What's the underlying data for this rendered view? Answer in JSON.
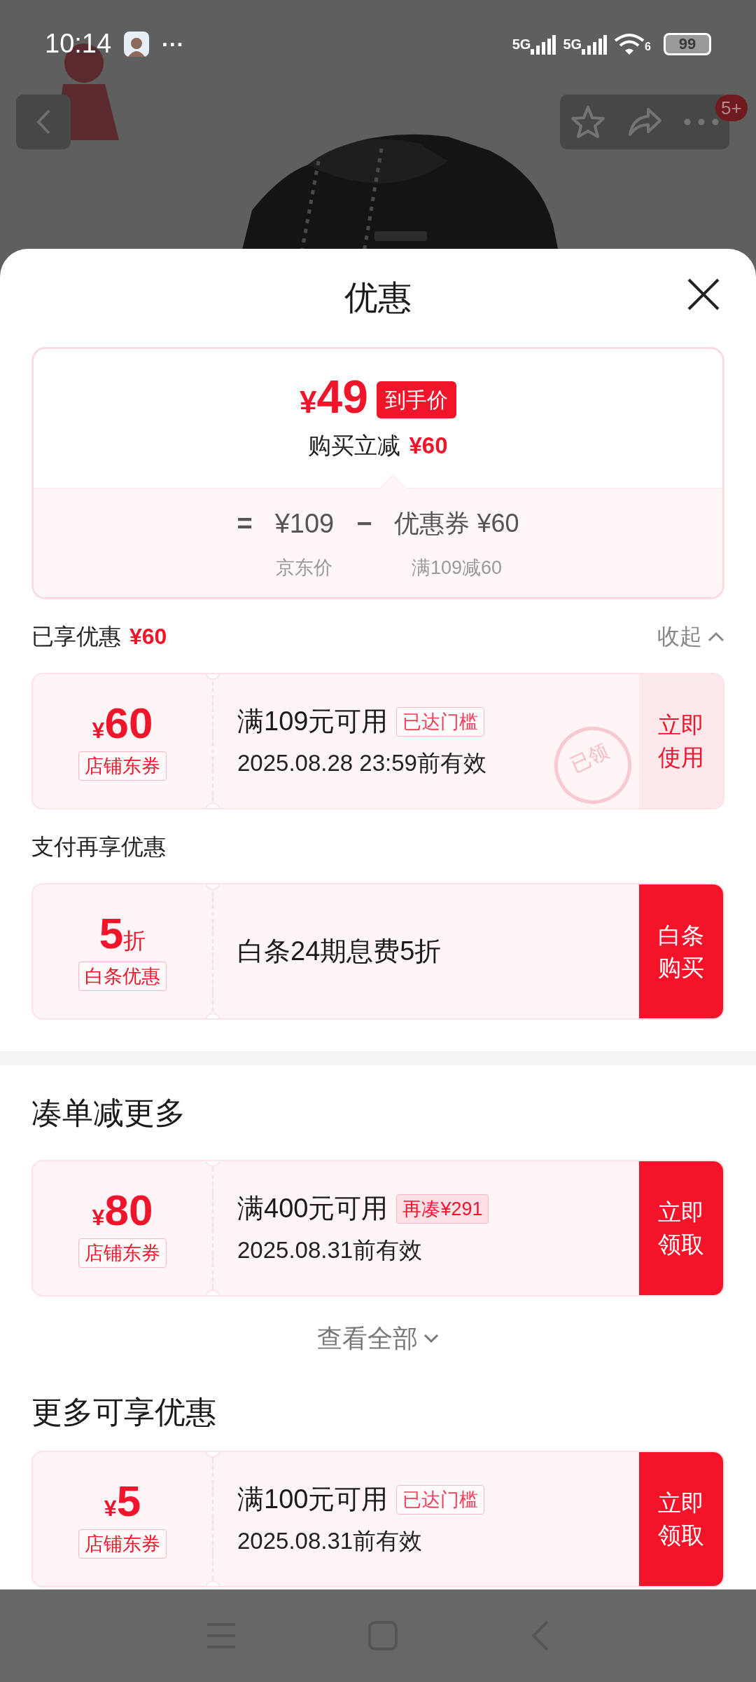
{
  "status_bar": {
    "time": "10:14",
    "more": "···",
    "networks": [
      "5G",
      "5G"
    ],
    "wifi_band": "6",
    "battery": "99"
  },
  "top_bar": {
    "badge": "5+"
  },
  "sheet": {
    "title": "优惠",
    "price_summary": {
      "currency": "¥",
      "price": "49",
      "price_tag": "到手价",
      "saving_label": "购买立减",
      "saving": "¥60",
      "equals": "=",
      "base_price": "¥109",
      "minus": "−",
      "discount": "优惠券 ¥60",
      "base_label": "京东价",
      "discount_label": "满109减60"
    },
    "applied": {
      "label": "已享优惠",
      "amount": "¥60",
      "toggle": "收起",
      "expanded": true
    },
    "applied_coupons": [
      {
        "currency": "¥",
        "value": "60",
        "tag": "店铺东券",
        "condition": "满109元可用",
        "badge": "已达门槛",
        "threshold_met": true,
        "validity": "2025.08.28 23:59前有效",
        "action": "立即使用",
        "received": true,
        "stamp": "已领"
      }
    ],
    "payment_heading": "支付再享优惠",
    "payment_offers": [
      {
        "value": "5",
        "suffix": "折",
        "tag": "白条优惠",
        "condition": "白条24期息费5折",
        "action": "白条购买",
        "received": false
      }
    ],
    "bundle": {
      "heading": "凑单减更多",
      "coupons": [
        {
          "currency": "¥",
          "value": "80",
          "tag": "店铺东券",
          "condition": "满400元可用",
          "badge": "再凑¥291",
          "threshold_met": false,
          "validity": "2025.08.31前有效",
          "action": "立即领取",
          "received": false
        }
      ],
      "view_all": "查看全部"
    },
    "more": {
      "heading": "更多可享优惠",
      "coupons": [
        {
          "currency": "¥",
          "value": "5",
          "tag": "店铺东券",
          "condition": "满100元可用",
          "badge": "已达门槛",
          "threshold_met": true,
          "validity": "2025.08.31前有效",
          "action": "立即领取",
          "received": false
        }
      ]
    }
  }
}
